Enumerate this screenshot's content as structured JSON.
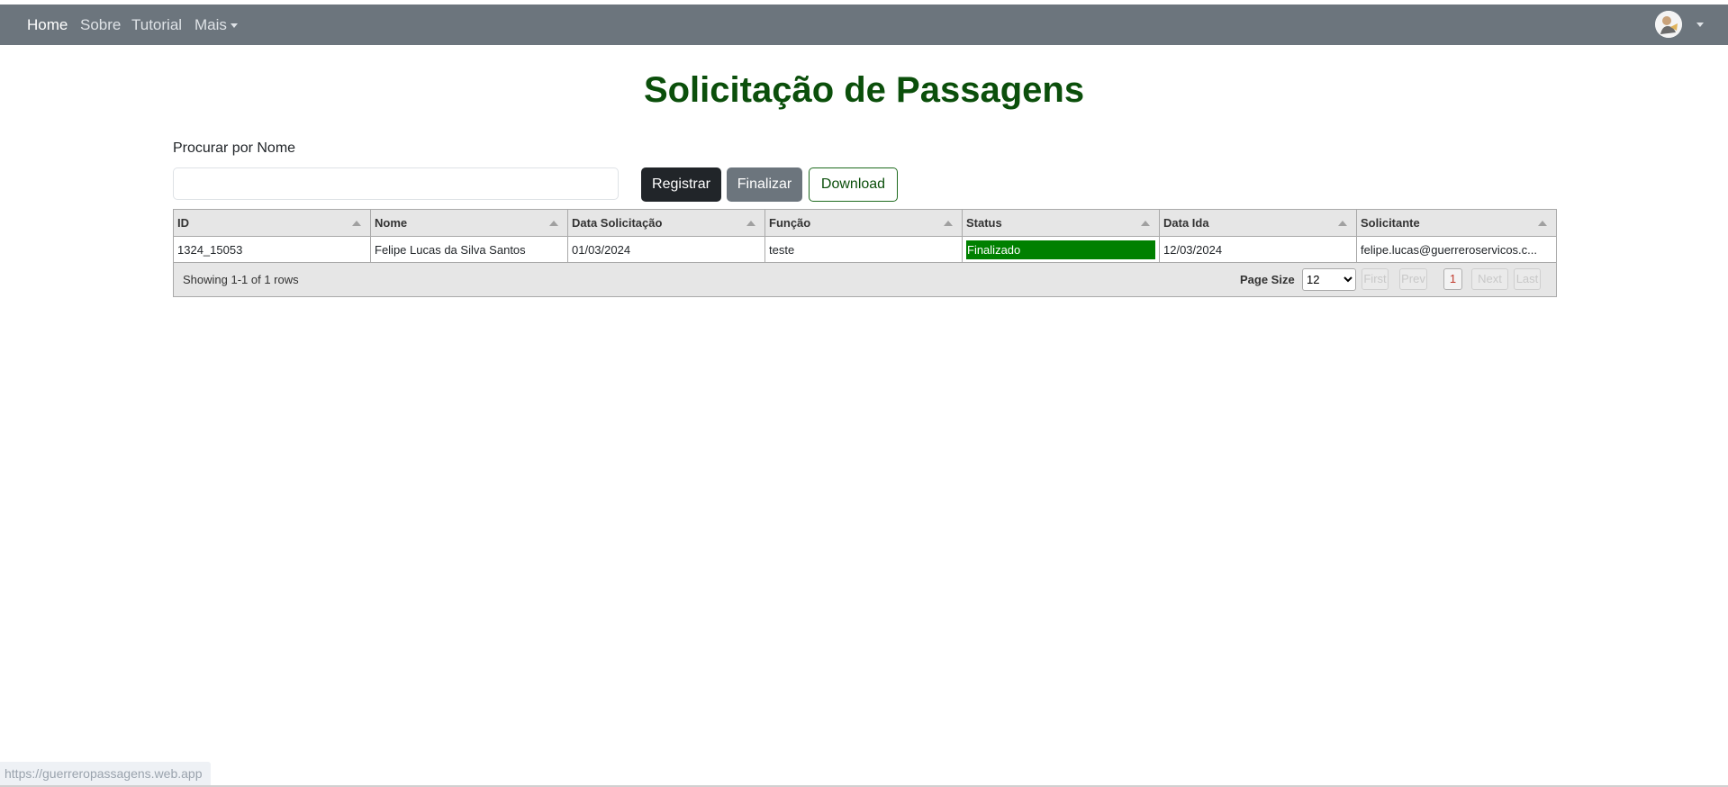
{
  "nav": {
    "items": [
      {
        "label": "Home",
        "active": true
      },
      {
        "label": "Sobre",
        "active": false
      },
      {
        "label": "Tutorial",
        "active": false
      },
      {
        "label": "Mais",
        "active": false,
        "dropdown": true
      }
    ],
    "user_icon": "avatar-icon"
  },
  "page": {
    "title": "Solicitação de Passagens",
    "search_label": "Procurar por Nome",
    "search_value": "",
    "buttons": {
      "register": "Registrar",
      "finish": "Finalizar",
      "download": "Download"
    }
  },
  "table": {
    "columns": [
      "ID",
      "Nome",
      "Data Solicitação",
      "Função",
      "Status",
      "Data Ida",
      "Solicitante"
    ],
    "rows": [
      [
        "1324_15053",
        "Felipe Lucas da Silva Santos",
        "01/03/2024",
        "teste",
        "Finalizado",
        "12/03/2024",
        "felipe.lucas@guerreroservicos.c..."
      ]
    ],
    "rows_info": "Showing 1-1 of 1 rows",
    "page_size_label": "Page Size",
    "page_size_value": "12",
    "pager": {
      "first": "First",
      "prev": "Prev",
      "current": "1",
      "next": "Next",
      "last": "Last"
    }
  },
  "colors": {
    "navbar": "#6c757d",
    "title": "#0b4f0b",
    "status_finalizado": "#008000"
  },
  "status_bar_url": "https://guerreropassagens.web.app"
}
